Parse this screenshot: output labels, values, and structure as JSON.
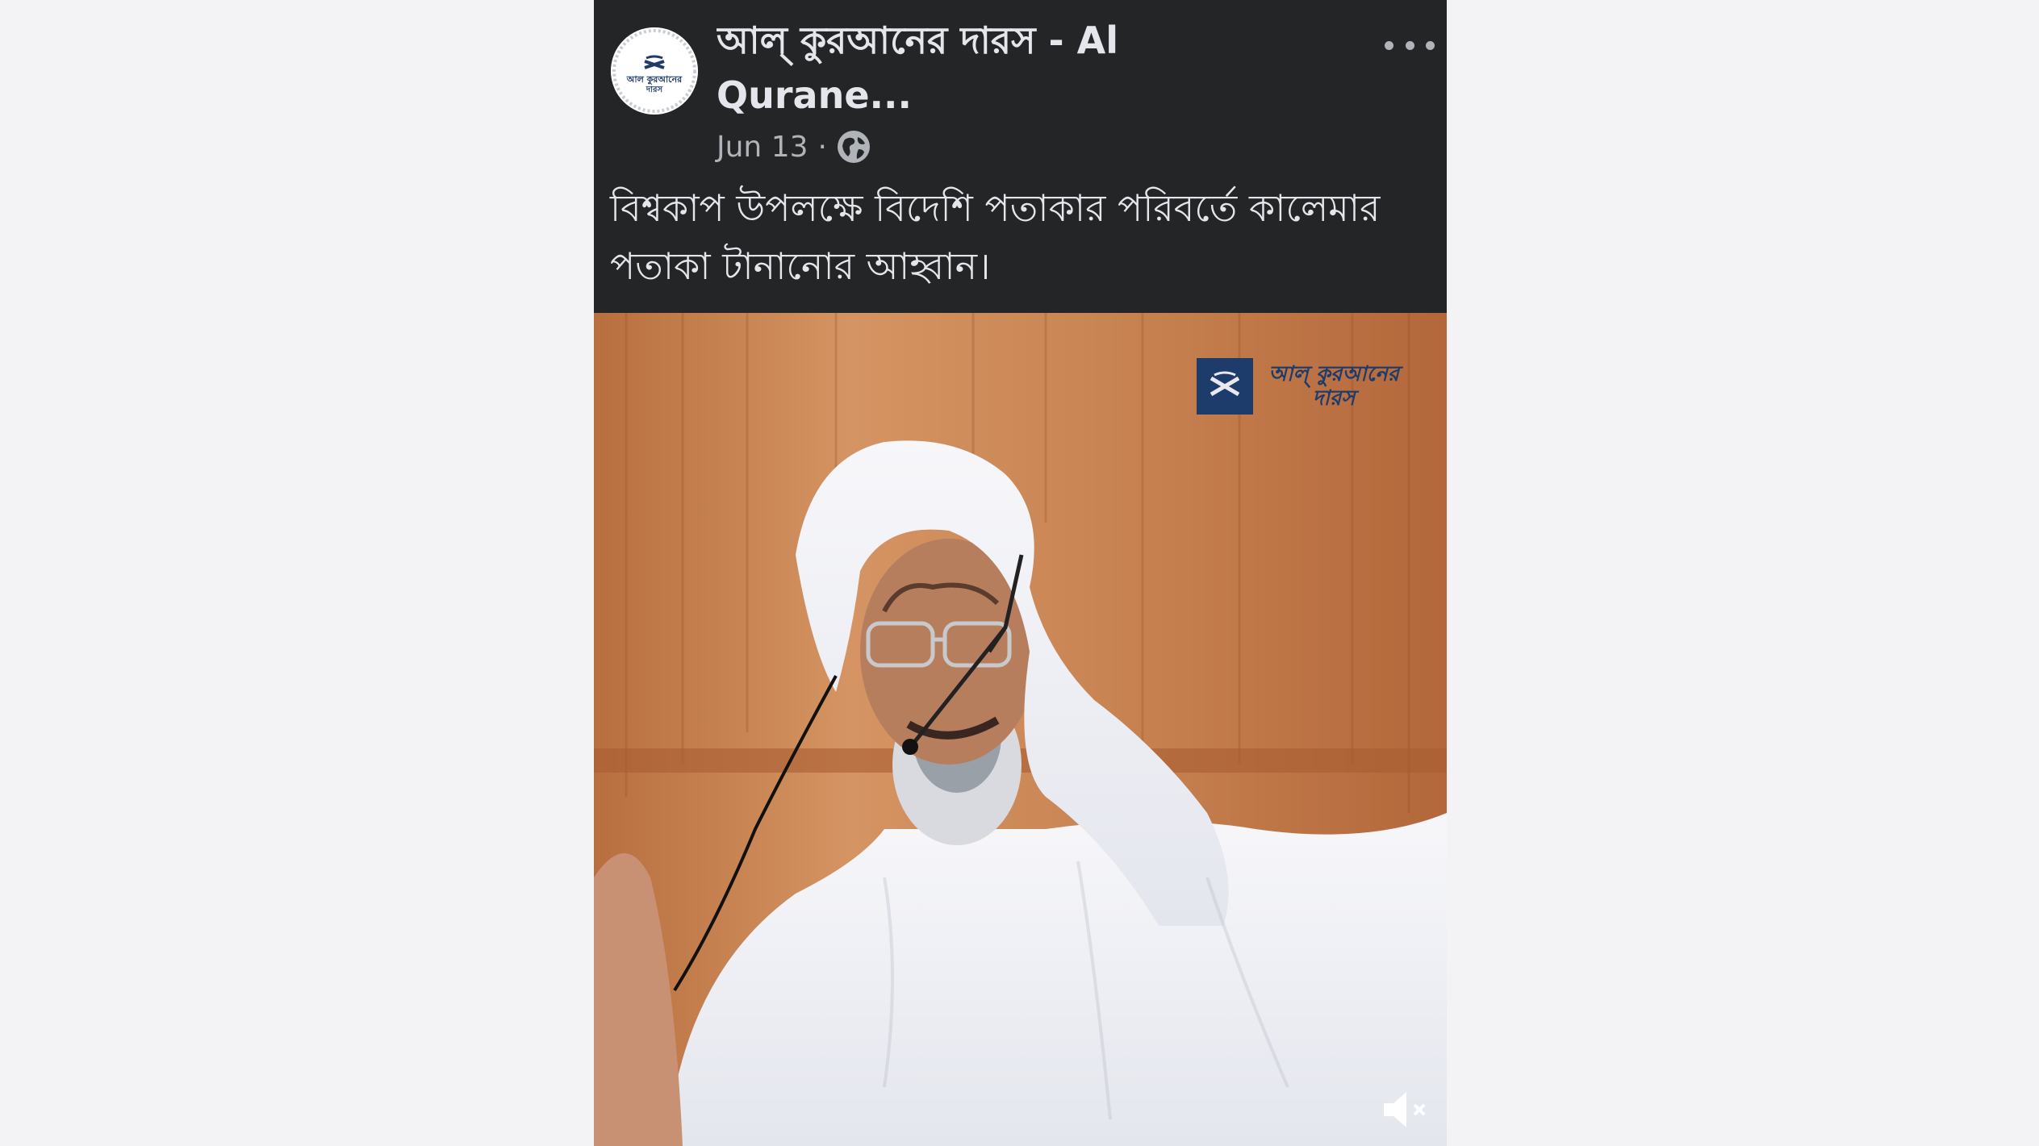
{
  "post": {
    "page_name": "আল্ কুরআনের দারস - Al Qurane...",
    "date": "Jun 13",
    "separator": "·",
    "privacy_icon": "globe-icon",
    "more_icon": "more-options-icon",
    "caption": "বিশ্বকাপ উপলক্ষে বিদেশি পতাকার পরিবর্তে কালেমার পতাকা টানানোর আহ্বান।"
  },
  "video": {
    "watermark_text": "আল্ কুরআনের দারস",
    "mute_icon": "muted-speaker-icon"
  },
  "colors": {
    "post_background": "#242526",
    "page_background": "#f3f3f5",
    "primary_text": "#e4e6eb",
    "secondary_text": "#b0b3b8",
    "logo_blue": "#1d3b6b"
  }
}
